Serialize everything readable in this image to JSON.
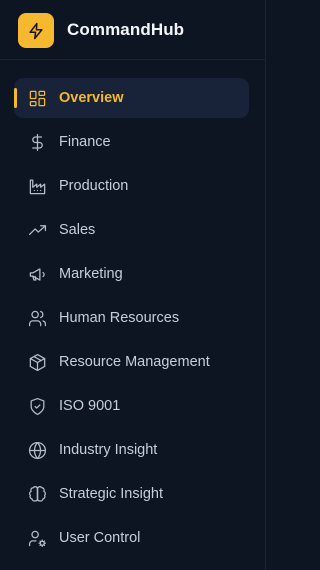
{
  "brand": {
    "name": "CommandHub",
    "logo_icon": "lightning-bolt-icon",
    "accent_color": "#f5b82e"
  },
  "nav": {
    "active": "Overview",
    "items": [
      {
        "label": "Overview",
        "icon": "dashboard-grid-icon"
      },
      {
        "label": "Finance",
        "icon": "dollar-sign-icon"
      },
      {
        "label": "Production",
        "icon": "factory-icon"
      },
      {
        "label": "Sales",
        "icon": "trending-up-icon"
      },
      {
        "label": "Marketing",
        "icon": "megaphone-icon"
      },
      {
        "label": "Human Resources",
        "icon": "users-icon"
      },
      {
        "label": "Resource Management",
        "icon": "package-box-icon"
      },
      {
        "label": "ISO 9001",
        "icon": "shield-check-icon"
      },
      {
        "label": "Industry Insight",
        "icon": "globe-icon"
      },
      {
        "label": "Strategic Insight",
        "icon": "brain-icon"
      },
      {
        "label": "User Control",
        "icon": "user-cog-icon"
      }
    ]
  }
}
